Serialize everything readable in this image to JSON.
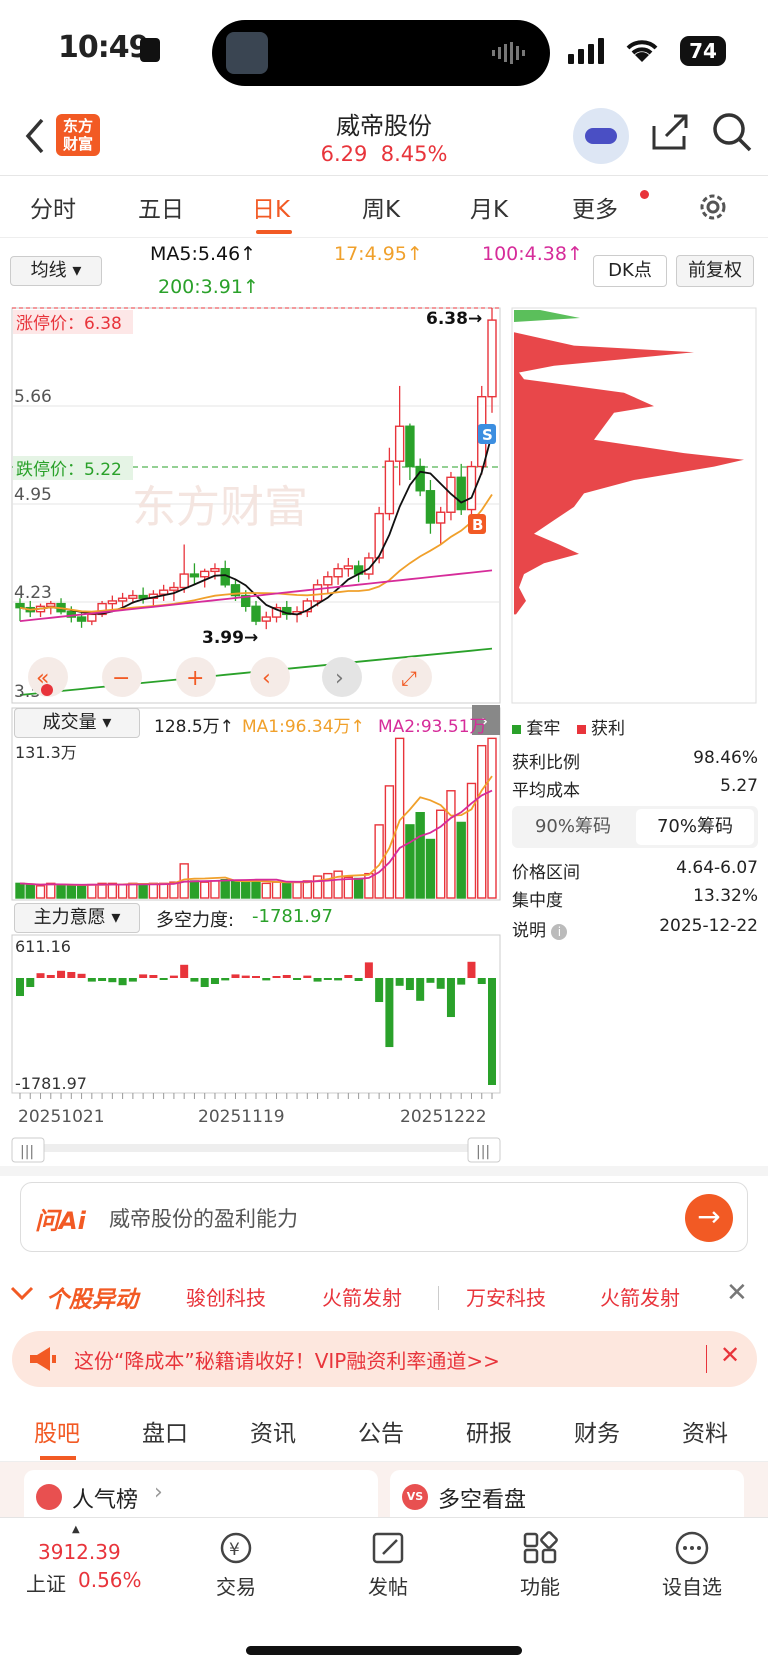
{
  "status": {
    "time": "10:49",
    "battery": "74"
  },
  "header": {
    "title": "威帝股份",
    "price": "6.29",
    "change": "8.45%",
    "logo": "东方\n财富"
  },
  "tabs": [
    "分时",
    "五日",
    "日K",
    "周K",
    "月K",
    "更多"
  ],
  "ma": {
    "selector": "均线",
    "ma5": "MA5:5.46↑",
    "ma17": "17:4.95↑",
    "ma100": "100:4.38↑",
    "ma200": "200:3.91↑",
    "dk": "DK点",
    "adj": "前复权"
  },
  "kline": {
    "limit_up": "涨停价：6.38",
    "limit_down": "跌停价：5.22",
    "y_top": "6.38",
    "y1": "5.66",
    "y2": "4.95",
    "y3": "4.23",
    "y_bot": "3.5",
    "hi": "6.38→",
    "lo": "3.99→",
    "watermark": "东方财富",
    "buy": "B",
    "sell": "S"
  },
  "chart_data": {
    "type": "candlestick",
    "dates_shown": [
      "20251021",
      "20251119",
      "20251222"
    ],
    "high": 6.38,
    "low": 3.99,
    "limit_up": 6.38,
    "limit_down": 5.22,
    "last": 6.29,
    "ohlc": [
      [
        4.18,
        4.22,
        4.05,
        4.15
      ],
      [
        4.15,
        4.2,
        4.08,
        4.12
      ],
      [
        4.12,
        4.18,
        4.08,
        4.16
      ],
      [
        4.16,
        4.2,
        4.1,
        4.18
      ],
      [
        4.18,
        4.22,
        4.1,
        4.12
      ],
      [
        4.12,
        4.16,
        4.04,
        4.08
      ],
      [
        4.08,
        4.12,
        4.0,
        4.05
      ],
      [
        4.05,
        4.12,
        4.02,
        4.1
      ],
      [
        4.1,
        4.2,
        4.08,
        4.18
      ],
      [
        4.18,
        4.24,
        4.12,
        4.2
      ],
      [
        4.2,
        4.26,
        4.14,
        4.22
      ],
      [
        4.22,
        4.28,
        4.18,
        4.24
      ],
      [
        4.24,
        4.3,
        4.18,
        4.22
      ],
      [
        4.22,
        4.28,
        4.16,
        4.25
      ],
      [
        4.25,
        4.32,
        4.2,
        4.28
      ],
      [
        4.28,
        4.34,
        4.2,
        4.3
      ],
      [
        4.3,
        4.62,
        4.26,
        4.4
      ],
      [
        4.4,
        4.48,
        4.32,
        4.38
      ],
      [
        4.38,
        4.44,
        4.3,
        4.42
      ],
      [
        4.42,
        4.48,
        4.36,
        4.44
      ],
      [
        4.44,
        4.5,
        4.3,
        4.32
      ],
      [
        4.32,
        4.36,
        4.2,
        4.24
      ],
      [
        4.24,
        4.28,
        4.12,
        4.16
      ],
      [
        4.16,
        4.2,
        4.02,
        4.05
      ],
      [
        4.05,
        4.12,
        3.99,
        4.08
      ],
      [
        4.08,
        4.18,
        4.04,
        4.15
      ],
      [
        4.15,
        4.2,
        4.06,
        4.1
      ],
      [
        4.1,
        4.16,
        4.04,
        4.12
      ],
      [
        4.12,
        4.22,
        4.08,
        4.2
      ],
      [
        4.2,
        4.36,
        4.16,
        4.32
      ],
      [
        4.32,
        4.42,
        4.26,
        4.38
      ],
      [
        4.38,
        4.48,
        4.32,
        4.44
      ],
      [
        4.44,
        4.52,
        4.38,
        4.46
      ],
      [
        4.46,
        4.5,
        4.34,
        4.4
      ],
      [
        4.4,
        4.56,
        4.36,
        4.52
      ],
      [
        4.52,
        4.9,
        4.48,
        4.85
      ],
      [
        4.85,
        5.34,
        4.8,
        5.24
      ],
      [
        5.24,
        5.8,
        5.06,
        5.5
      ],
      [
        5.5,
        5.52,
        5.1,
        5.2
      ],
      [
        5.2,
        5.26,
        4.98,
        5.02
      ],
      [
        5.02,
        5.1,
        4.7,
        4.78
      ],
      [
        4.78,
        4.9,
        4.62,
        4.86
      ],
      [
        4.86,
        5.16,
        4.8,
        5.12
      ],
      [
        5.12,
        5.22,
        4.84,
        4.88
      ],
      [
        4.88,
        5.24,
        4.8,
        5.2
      ],
      [
        5.2,
        5.8,
        5.14,
        5.72
      ],
      [
        5.72,
        6.38,
        5.6,
        6.29
      ]
    ],
    "volume": [
      12,
      11,
      10,
      12,
      11,
      10,
      10,
      11,
      12,
      12,
      11,
      12,
      11,
      12,
      12,
      13,
      28,
      14,
      13,
      14,
      15,
      14,
      13,
      14,
      12,
      13,
      12,
      13,
      14,
      18,
      20,
      22,
      17,
      16,
      20,
      60,
      92,
      131,
      60,
      70,
      48,
      72,
      88,
      62,
      94,
      125,
      131
    ],
    "zlyy": [
      -300,
      -150,
      80,
      50,
      120,
      100,
      70,
      -60,
      -50,
      -70,
      -120,
      -60,
      60,
      50,
      -20,
      40,
      220,
      -60,
      -150,
      -100,
      -40,
      60,
      40,
      30,
      -40,
      30,
      50,
      -30,
      40,
      -60,
      -30,
      -40,
      50,
      -50,
      260,
      -400,
      -1150,
      -130,
      -200,
      -380,
      -80,
      -180,
      -650,
      -110,
      270,
      -100,
      -1782
    ]
  },
  "vol": {
    "selector": "成交量",
    "val": "128.5万↑",
    "ma1": "MA1:96.34万↑",
    "ma2": "MA2:93.51万",
    "top": "131.3万"
  },
  "ind": {
    "selector": "主力意愿",
    "label": "多空力度:",
    "val": "-1781.97",
    "top": "611.16",
    "bot": "-1781.97"
  },
  "dates": [
    "20251021",
    "20251119",
    "20251222"
  ],
  "chips": {
    "legend_trap": "套牢",
    "legend_profit": "获利",
    "rows": [
      [
        "获利比例",
        "98.46%"
      ],
      [
        "平均成本",
        "5.27"
      ]
    ],
    "tab90": "90%筹码",
    "tab70": "70%筹码",
    "rows2": [
      [
        "价格区间",
        "4.64-6.07"
      ],
      [
        "集中度",
        "13.32%"
      ],
      [
        "说明",
        "2025-12-22"
      ]
    ]
  },
  "ai": {
    "brand": "问Ai",
    "prompt": "威帝股份的盈利能力"
  },
  "movers": {
    "title": "个股异动",
    "items": [
      "骏创科技",
      "火箭发射",
      "万安科技",
      "火箭发射"
    ]
  },
  "banner": "这份“降成本”秘籍请收好！VIP融资利率通道>>",
  "bottom_tabs": [
    "股吧",
    "盘口",
    "资讯",
    "公告",
    "研报",
    "财务",
    "资料"
  ],
  "cards": [
    "人气榜",
    "多空看盘"
  ],
  "tabbar": {
    "index_val": "3912.39",
    "index_name": "上证",
    "index_pct": "0.56%",
    "items": [
      "交易",
      "发帖",
      "功能",
      "设自选"
    ]
  }
}
